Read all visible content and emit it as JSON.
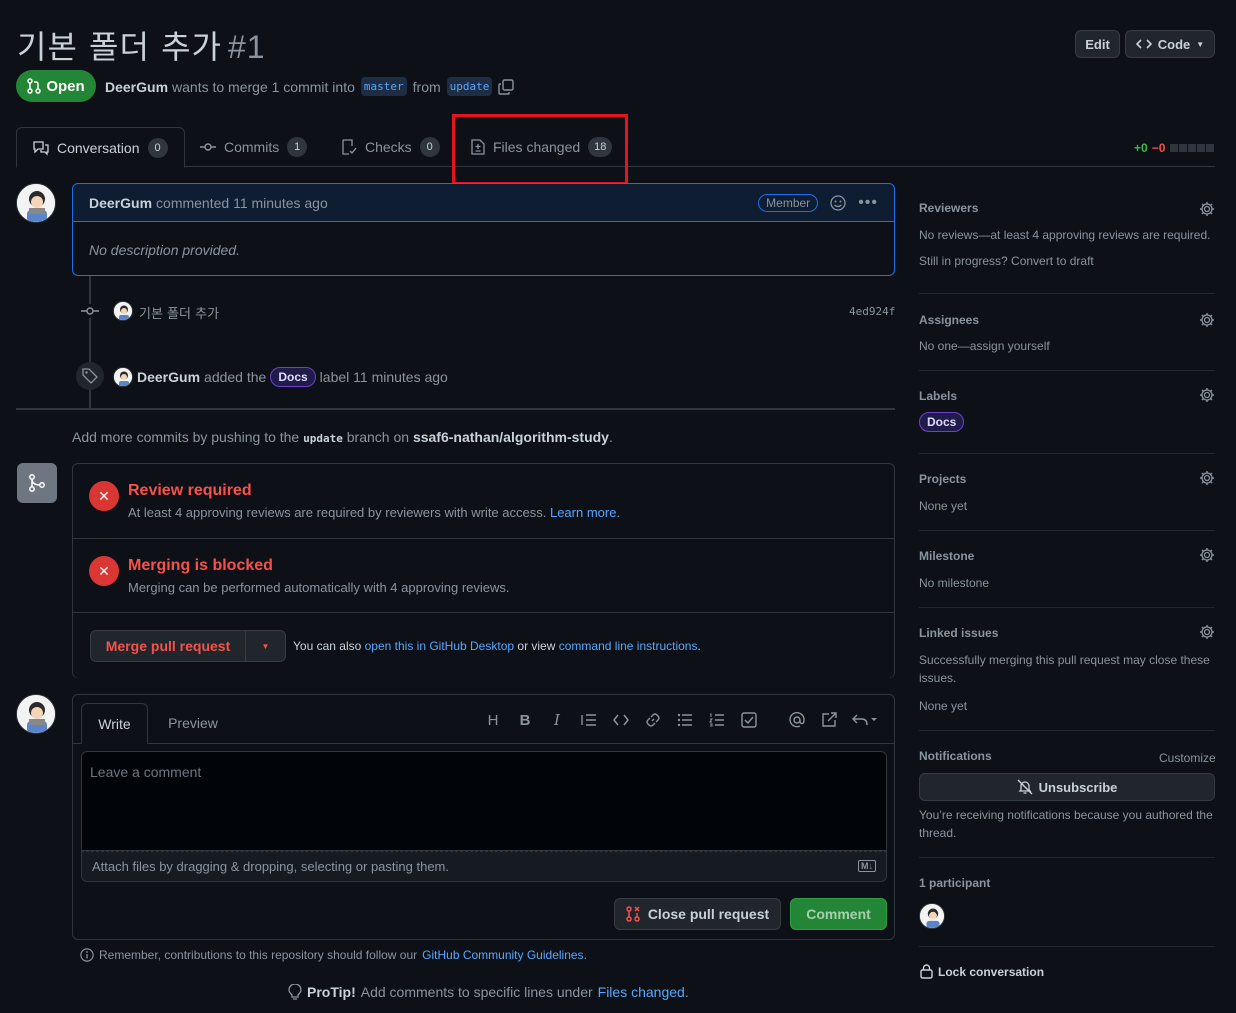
{
  "pr": {
    "title": "기본 폴더 추가",
    "number": "#1",
    "state": "Open",
    "author": "DeerGum",
    "merge_text": "wants to merge 1 commit into",
    "base_branch": "master",
    "from_text": "from",
    "head_branch": "update"
  },
  "header_buttons": {
    "edit": "Edit",
    "code": "Code"
  },
  "tabs": [
    {
      "label": "Conversation",
      "count": "0"
    },
    {
      "label": "Commits",
      "count": "1"
    },
    {
      "label": "Checks",
      "count": "0"
    },
    {
      "label": "Files changed",
      "count": "18"
    }
  ],
  "diffstat": {
    "additions": "+0",
    "deletions": "−0"
  },
  "comment": {
    "author": "DeerGum",
    "meta": "commented 11 minutes ago",
    "badge": "Member",
    "body": "No description provided."
  },
  "commit_event": {
    "message": "기본 폴더 추가",
    "sha": "4ed924f"
  },
  "label_event": {
    "actor": "DeerGum",
    "pre": "added the",
    "label": "Docs",
    "post": "label 11 minutes ago"
  },
  "push_hint": {
    "pre": "Add more commits by pushing to the",
    "branch": "update",
    "mid": "branch on",
    "repo": "ssaf6-nathan/algorithm-study",
    "end": "."
  },
  "merge_box": {
    "review_title": "Review required",
    "review_desc": "At least 4 approving reviews are required by reviewers with write access.",
    "review_link": "Learn more.",
    "blocked_title": "Merging is blocked",
    "blocked_desc": "Merging can be performed automatically with 4 approving reviews.",
    "merge_button": "Merge pull request",
    "also_pre": "You can also",
    "also_link1": "open this in GitHub Desktop",
    "also_mid": "or view",
    "also_link2": "command line instructions",
    "also_end": "."
  },
  "editor": {
    "write_tab": "Write",
    "preview_tab": "Preview",
    "placeholder": "Leave a comment",
    "attach_text": "Attach files by dragging & dropping, selecting or pasting them.",
    "md_badge": "M↓",
    "close_button": "Close pull request",
    "comment_button": "Comment"
  },
  "footer": {
    "remember_pre": "Remember, contributions to this repository should follow our",
    "remember_link": "GitHub Community Guidelines",
    "remember_end": ".",
    "protip_bold": "ProTip!",
    "protip_text": "Add comments to specific lines under",
    "protip_link": "Files changed",
    "protip_end": "."
  },
  "sidebar": {
    "reviewers_h": "Reviewers",
    "reviewers_t1": "No reviews—at least 4 approving reviews are required.",
    "reviewers_t2": "Still in progress? Convert to draft",
    "assignees_h": "Assignees",
    "assignees_t": "No one—assign yourself",
    "labels_h": "Labels",
    "labels_v": "Docs",
    "projects_h": "Projects",
    "projects_t": "None yet",
    "milestone_h": "Milestone",
    "milestone_t": "No milestone",
    "linked_h": "Linked issues",
    "linked_t": "Successfully merging this pull request may close these issues.",
    "linked_t2": "None yet",
    "notif_h": "Notifications",
    "notif_customize": "Customize",
    "unsubscribe": "Unsubscribe",
    "notif_t": "You’re receiving notifications because you authored the thread.",
    "participants_h": "1 participant",
    "lock": "Lock conversation"
  },
  "colors": {
    "open_green": "#238636",
    "accent_blue": "#58a6ff",
    "danger": "#da3633",
    "highlight_box": "#e3141f"
  }
}
